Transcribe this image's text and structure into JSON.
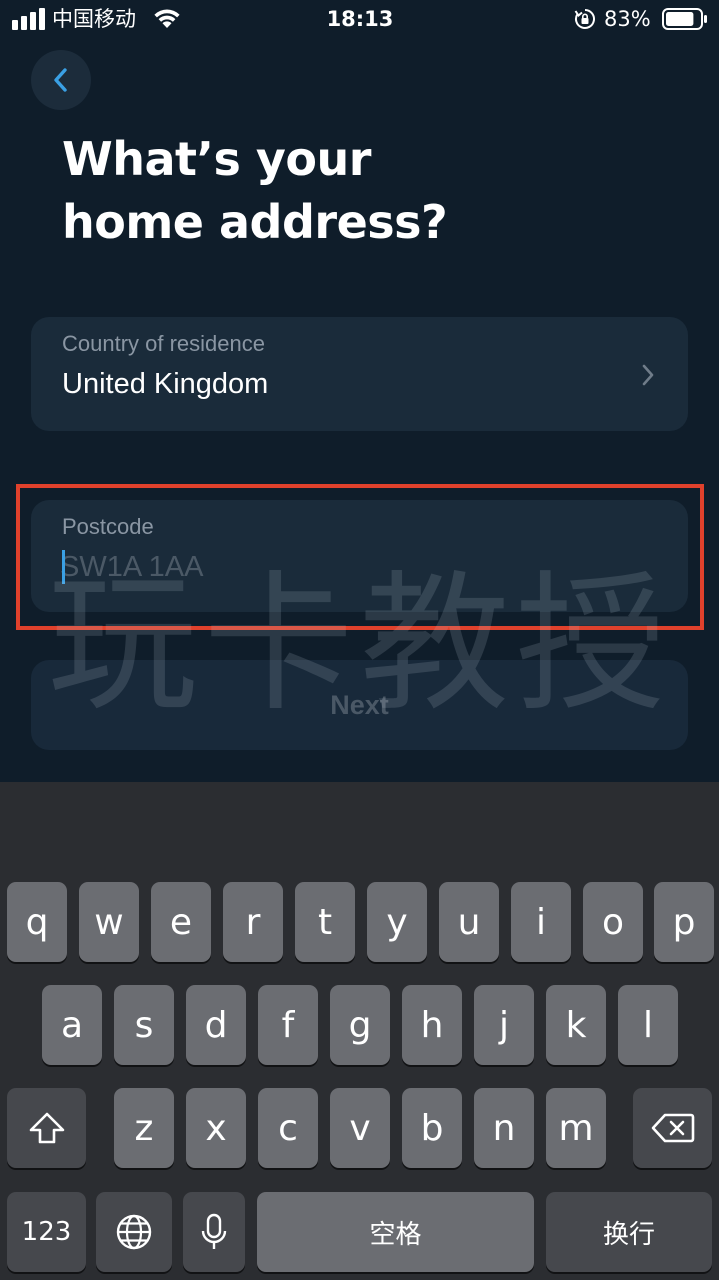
{
  "status_bar": {
    "carrier": "中国移动",
    "time": "18:13",
    "battery_percent": "83%",
    "battery_level": 0.83
  },
  "header": {
    "back_icon": "chevron-left-icon",
    "title_line1": "What’s your",
    "title_line2": "home address?"
  },
  "country_field": {
    "label": "Country of residence",
    "value": "United Kingdom",
    "icon": "chevron-right-icon"
  },
  "postcode_field": {
    "label": "Postcode",
    "value": "",
    "placeholder": "SW1A 1AA"
  },
  "next_button": {
    "label": "Next"
  },
  "watermark": "玩卡教授",
  "colors": {
    "background": "#0f1d2a",
    "field_background": "#1a2b3a",
    "accent": "#3aa0e4",
    "highlight": "#e0412c",
    "key": "#6b6d72",
    "key_dark": "#46484d"
  },
  "keyboard": {
    "row1": [
      "q",
      "w",
      "e",
      "r",
      "t",
      "y",
      "u",
      "i",
      "o",
      "p"
    ],
    "row2": [
      "a",
      "s",
      "d",
      "f",
      "g",
      "h",
      "j",
      "k",
      "l"
    ],
    "row3": [
      "z",
      "x",
      "c",
      "v",
      "b",
      "n",
      "m"
    ],
    "shift_icon": "shift-icon",
    "delete_icon": "backspace-icon",
    "numbers_label": "123",
    "globe_icon": "globe-icon",
    "mic_icon": "microphone-icon",
    "space_label": "空格",
    "return_label": "换行"
  }
}
